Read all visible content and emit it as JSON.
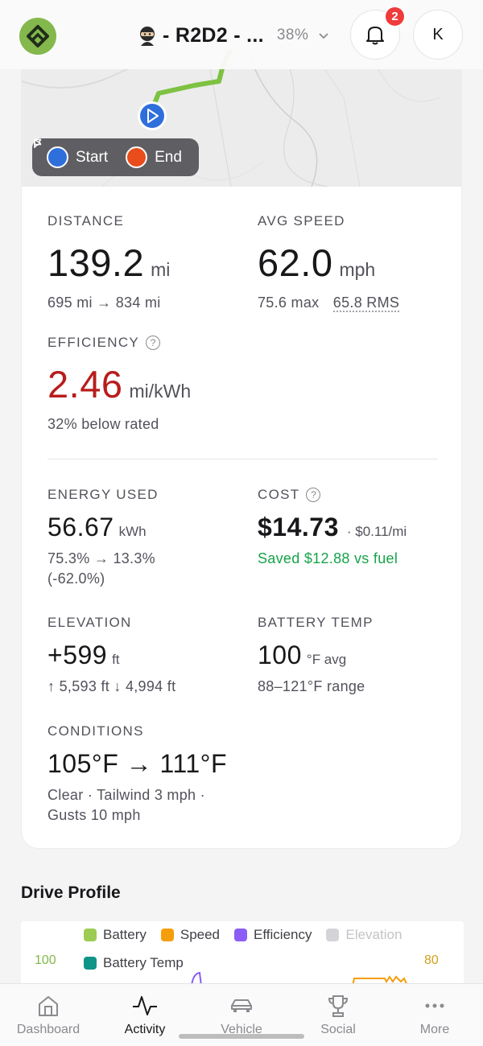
{
  "header": {
    "vehicle_name": "- R2D2 - ...",
    "battery_pct": "38%",
    "notification_count": "2",
    "avatar_initial": "K"
  },
  "map": {
    "legend_start": "Start",
    "legend_end": "End"
  },
  "stats": {
    "distance": {
      "label": "DISTANCE",
      "value": "139.2",
      "unit": "mi",
      "sub": "695 mi → 834 mi"
    },
    "avg_speed": {
      "label": "AVG SPEED",
      "value": "62.0",
      "unit": "mph",
      "max": "75.6 max",
      "rms": "65.8 RMS"
    },
    "efficiency": {
      "label": "EFFICIENCY",
      "value": "2.46",
      "unit": "mi/kWh",
      "sub": "32% below rated"
    },
    "energy_used": {
      "label": "ENERGY USED",
      "value": "56.67",
      "unit": "kWh",
      "sub_line1": "75.3% → 13.3%",
      "sub_line2": "(-62.0%)"
    },
    "cost": {
      "label": "COST",
      "value": "$14.73",
      "per_mile": "· $0.11/mi",
      "saved": "Saved $12.88 vs fuel"
    },
    "elevation": {
      "label": "ELEVATION",
      "value": "+599",
      "unit": "ft",
      "sub": "↑ 5,593 ft  ↓ 4,994 ft"
    },
    "battery_temp": {
      "label": "BATTERY TEMP",
      "value": "100",
      "unit": "°F avg",
      "sub": "88–121°F range"
    },
    "conditions": {
      "label": "CONDITIONS",
      "value": "105°F → 111°F",
      "sub_line1": "Clear · Tailwind 3 mph ·",
      "sub_line2": "Gusts 10 mph"
    }
  },
  "drive_profile": {
    "title": "Drive Profile",
    "legend": [
      {
        "label": "Battery",
        "color": "#9ccc52"
      },
      {
        "label": "Speed",
        "color": "#f59e0b"
      },
      {
        "label": "Efficiency",
        "color": "#8b5cf6"
      },
      {
        "label": "Elevation",
        "color": "#d4d4d8"
      },
      {
        "label": "Battery Temp",
        "color": "#0f9488"
      }
    ],
    "left_axis_top": "100",
    "right_axis_top": "80"
  },
  "nav": {
    "items": [
      {
        "label": "Dashboard"
      },
      {
        "label": "Activity"
      },
      {
        "label": "Vehicle"
      },
      {
        "label": "Social"
      },
      {
        "label": "More"
      }
    ]
  },
  "colors": {
    "accent_green": "#84b84c",
    "route_green": "#7dc242",
    "start_blue": "#2f6fdc",
    "end_orange": "#ea4c1c",
    "efficiency_red": "#b91c1c",
    "saved_green": "#16a34a",
    "badge_red": "#ef3b3b"
  }
}
